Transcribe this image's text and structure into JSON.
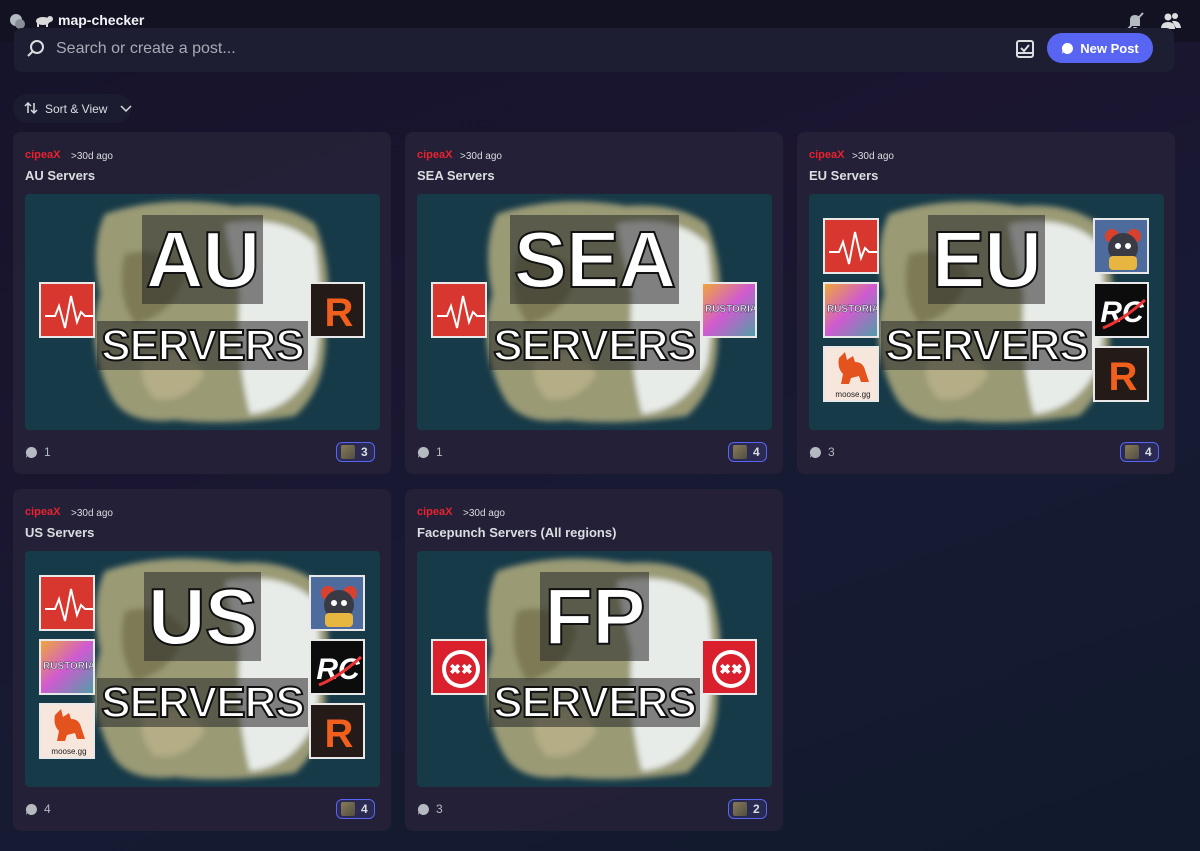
{
  "header": {
    "channel_name": "map-checker",
    "icons": [
      "forum-icon",
      "channel-emoji-icon",
      "mute-notifications-icon",
      "members-icon"
    ]
  },
  "search": {
    "placeholder": "Search or create a post...",
    "new_post_label": "New Post"
  },
  "sort_view": {
    "label": "Sort & View"
  },
  "colors": {
    "accent": "#5865f2",
    "author": "#e8232f",
    "thumb_bg": "#173a48"
  },
  "posts": [
    {
      "author": "cipeaX",
      "time": ">30d ago",
      "title": "AU Servers",
      "thumb_line1": "AU",
      "thumb_line2": "SERVERS",
      "left_logos": [
        "pulse"
      ],
      "right_logos": [
        "r-orange"
      ],
      "messages": "1",
      "reactions": "3"
    },
    {
      "author": "cipeaX",
      "time": ">30d ago",
      "title": "SEA Servers",
      "thumb_line1": "SEA",
      "thumb_line2": "SERVERS",
      "left_logos": [
        "pulse"
      ],
      "right_logos": [
        "rustoria"
      ],
      "logo_text": {
        "rustoria": "RUSTORIA"
      },
      "messages": "1",
      "reactions": "4"
    },
    {
      "author": "cipeaX",
      "time": ">30d ago",
      "title": "EU Servers",
      "thumb_line1": "EU",
      "thumb_line2": "SERVERS",
      "left_logos": [
        "pulse",
        "rustoria",
        "moose"
      ],
      "right_logos": [
        "bear",
        "rc",
        "r-orange"
      ],
      "logo_text": {
        "rustoria": "RUSTORIA",
        "moose": "moose.gg"
      },
      "messages": "3",
      "reactions": "4"
    },
    {
      "author": "cipeaX",
      "time": ">30d ago",
      "title": "US Servers",
      "thumb_line1": "US",
      "thumb_line2": "SERVERS",
      "left_logos": [
        "pulse",
        "rustoria",
        "moose"
      ],
      "right_logos": [
        "bear",
        "rc",
        "r-orange"
      ],
      "logo_text": {
        "rustoria": "RUSTORIA",
        "moose": "moose.gg"
      },
      "messages": "4",
      "reactions": "4"
    },
    {
      "author": "cipeaX",
      "time": ">30d ago",
      "title": "Facepunch Servers (All regions)",
      "thumb_line1": "FP",
      "thumb_line2": "SERVERS",
      "left_logos": [
        "facepunch"
      ],
      "right_logos": [
        "facepunch"
      ],
      "messages": "3",
      "reactions": "2"
    }
  ]
}
